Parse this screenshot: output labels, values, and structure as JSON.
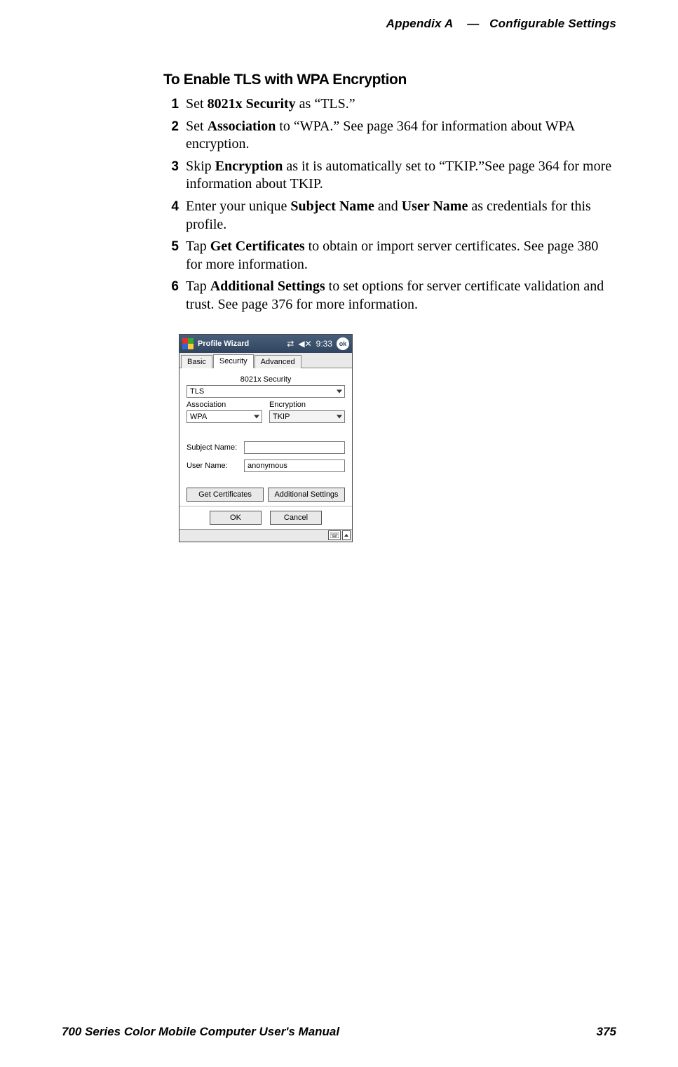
{
  "header": {
    "appendix": "Appendix A",
    "sep": "—",
    "section": "Configurable Settings"
  },
  "title": "To Enable TLS with WPA Encryption",
  "steps": [
    {
      "num": "1",
      "pre": "Set ",
      "bold": "8021x Security",
      "post": " as “TLS.”"
    },
    {
      "num": "2",
      "pre": "Set ",
      "bold": "Association",
      "post": " to “WPA.” See page 364 for information about WPA encryption."
    },
    {
      "num": "3",
      "pre": "Skip ",
      "bold": "Encryption",
      "post": " as it is automatically set to “TKIP.”See page 364 for more information about TKIP."
    },
    {
      "num": "4",
      "pre": "Enter your unique ",
      "bold": "Subject Name",
      "mid": " and ",
      "bold2": "User Name",
      "post": " as credentials for this profile."
    },
    {
      "num": "5",
      "pre": "Tap ",
      "bold": "Get Certificates",
      "post": " to obtain or import server certificates. See page 380 for more information."
    },
    {
      "num": "6",
      "pre": "Tap ",
      "bold": "Additional Settings",
      "post": " to set options for server certificate validation and trust. See page 376 for more information."
    }
  ],
  "shot": {
    "titlebar": {
      "title": "Profile Wizard",
      "time": "9:33",
      "ok": "ok"
    },
    "tabs": {
      "basic": "Basic",
      "security": "Security",
      "advanced": "Advanced"
    },
    "labels": {
      "sec8021x": "8021x Security",
      "assoc": "Association",
      "enc": "Encryption",
      "subj": "Subject Name:",
      "user": "User Name:"
    },
    "values": {
      "sec8021x": "TLS",
      "assoc": "WPA",
      "enc": "TKIP",
      "subj": "",
      "user": "anonymous"
    },
    "buttons": {
      "getcerts": "Get Certificates",
      "addl": "Additional Settings",
      "ok": "OK",
      "cancel": "Cancel"
    }
  },
  "footer": {
    "manual": "700 Series Color Mobile Computer User's Manual",
    "page": "375"
  }
}
